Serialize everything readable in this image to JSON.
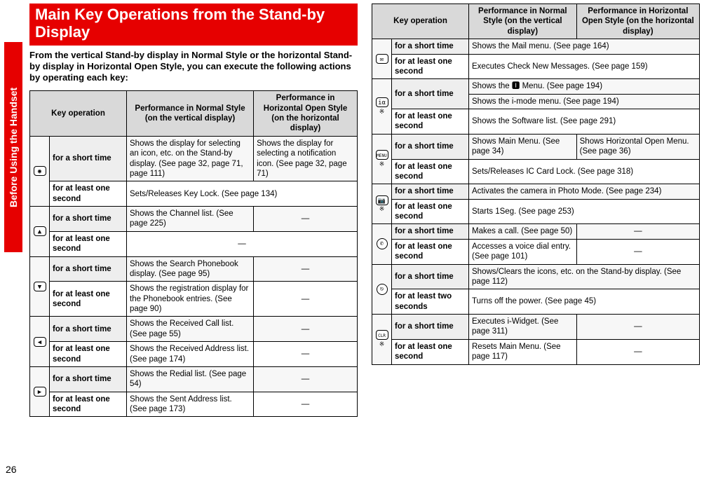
{
  "side_tab": "Before Using the Handset",
  "page_number": "26",
  "title": "Main Key Operations from the Stand-by Display",
  "intro": "From the vertical Stand-by display in Normal Style or the horizontal Stand-by display in Horizontal Open Style, you can execute the following actions by operating each key:",
  "headers": {
    "key_op": "Key operation",
    "normal": "Performance in Normal Style (on the vertical display)",
    "horizontal": "Performance in Horizontal Open Style (on the horizontal display)"
  },
  "dur": {
    "short": "for a short time",
    "one": "for at least one second",
    "two": "for at least two seconds"
  },
  "left_rows": [
    {
      "icon": "nav-center-icon",
      "short": {
        "n": "Shows the display for selecting an icon, etc. on the Stand-by display. (See page 32, page 71, page 111)",
        "h": "Shows the display for selecting a notification icon. (See page 32, page 71)"
      },
      "one": {
        "span": "Sets/Releases Key Lock. (See page 134)"
      }
    },
    {
      "icon": "nav-up-icon",
      "short": {
        "n": "Shows the Channel list. (See page 225)",
        "h": "—"
      },
      "one": {
        "span": "—"
      }
    },
    {
      "icon": "nav-down-icon",
      "short": {
        "n": "Shows the Search Phonebook display. (See page 95)",
        "h": "—"
      },
      "one": {
        "n": "Shows the registration display for the Phonebook entries. (See page 90)",
        "h": "—"
      }
    },
    {
      "icon": "nav-left-icon",
      "short": {
        "n": "Shows the Received Call list. (See page 55)",
        "h": "—"
      },
      "one": {
        "n": "Shows the Received Address list. (See page 174)",
        "h": "—"
      }
    },
    {
      "icon": "nav-right-icon",
      "short": {
        "n": "Shows the Redial list. (See page 54)",
        "h": "—"
      },
      "one": {
        "n": "Shows the Sent Address list. (See page 173)",
        "h": "—"
      }
    }
  ],
  "right_rows": [
    {
      "icon": "mail-key-icon",
      "short": {
        "span": "Shows the Mail menu. (See page 164)"
      },
      "one": {
        "span": "Executes Check New Messages. (See page 159)"
      }
    },
    {
      "icon": "i-alpha-key-icon",
      "short": [
        {
          "span": "Shows the 🅸 Menu. (See page 194)"
        },
        {
          "span": "Shows the i-mode menu. (See page 194)"
        }
      ],
      "one": {
        "span": "Shows the Software list. (See page 291)"
      },
      "one_note": "※"
    },
    {
      "icon": "menu-key-icon",
      "short": {
        "n": "Shows Main Menu. (See page 34)",
        "h": "Shows Horizontal Open Menu. (See page 36)"
      },
      "one": {
        "span": "Sets/Releases IC Card Lock. (See page 318)"
      },
      "one_note": "※"
    },
    {
      "icon": "camera-key-icon",
      "short": {
        "span": "Activates the camera in Photo Mode. (See page 234)"
      },
      "one": {
        "span": "Starts 1Seg. (See page 253)"
      },
      "one_note": "※"
    },
    {
      "icon": "call-key-icon",
      "short": {
        "n": "Makes a call. (See page 50)",
        "h": "—"
      },
      "one": {
        "n": "Accesses a voice dial entry. (See page 101)",
        "h": "—"
      }
    },
    {
      "icon": "power-key-icon",
      "short": {
        "span": "Shows/Clears the icons, etc. on the Stand-by display. (See page 112)"
      },
      "two": {
        "span": "Turns off the power. (See page 45)"
      }
    },
    {
      "icon": "clr-key-icon",
      "short": {
        "n": "Executes i-Widget. (See page 311)",
        "h": "—"
      },
      "one": {
        "n": "Resets Main Menu. (See page 117)",
        "h": "—"
      },
      "one_note": "※"
    }
  ]
}
